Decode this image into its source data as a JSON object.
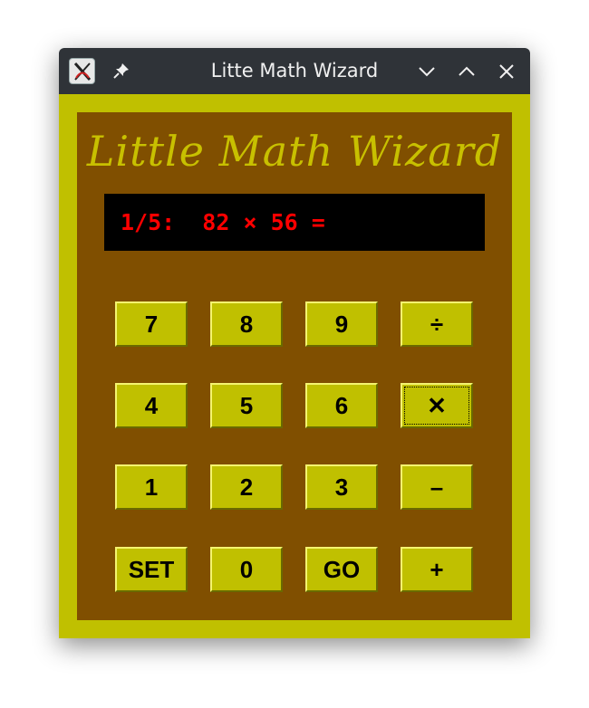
{
  "window": {
    "title": "Litte Math Wizard"
  },
  "app": {
    "heading": "Little Math Wizard",
    "display": "1/5:  82 × 56 ="
  },
  "keypad": {
    "rows": [
      [
        "7",
        "8",
        "9",
        "÷"
      ],
      [
        "4",
        "5",
        "6",
        "✕"
      ],
      [
        "1",
        "2",
        "3",
        "–"
      ],
      [
        "SET",
        "0",
        "GO",
        "+"
      ]
    ],
    "active_key": "✕"
  },
  "colors": {
    "frame": "#c0c000",
    "panel": "#804f00",
    "heading": "#c8c000",
    "display_bg": "#000000",
    "display_text": "#ff0000",
    "titlebar": "#2f3338"
  },
  "icons": {
    "app_icon": "x-window-icon",
    "pin": "pin-icon",
    "minimize": "chevron-down-icon",
    "maximize": "chevron-up-icon",
    "close": "close-icon"
  }
}
